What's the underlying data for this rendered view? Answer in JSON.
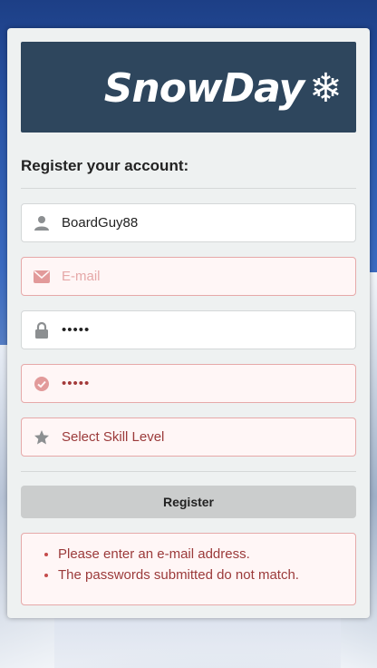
{
  "brand": {
    "name": "SnowDay"
  },
  "form": {
    "heading": "Register your account:",
    "username": {
      "value": "BoardGuy88"
    },
    "email": {
      "placeholder": "E-mail",
      "value": ""
    },
    "password": {
      "value": "•••••"
    },
    "confirm_password": {
      "value": "•••••"
    },
    "skill_level": {
      "selected": "Select Skill Level"
    },
    "register_label": "Register"
  },
  "errors": [
    "Please enter an e-mail address.",
    "The passwords submitted do not match."
  ],
  "colors": {
    "banner": "#2e465d",
    "error_text": "#9b3a3a",
    "error_border": "#e6a9a9",
    "error_bg": "#fff6f6",
    "button_bg": "#cbcdcd"
  },
  "icons": {
    "username": "user-icon",
    "email": "envelope-icon",
    "password": "lock-icon",
    "confirm_password": "check-circle-icon",
    "skill_level": "star-icon",
    "logo": "snowflake-icon"
  }
}
